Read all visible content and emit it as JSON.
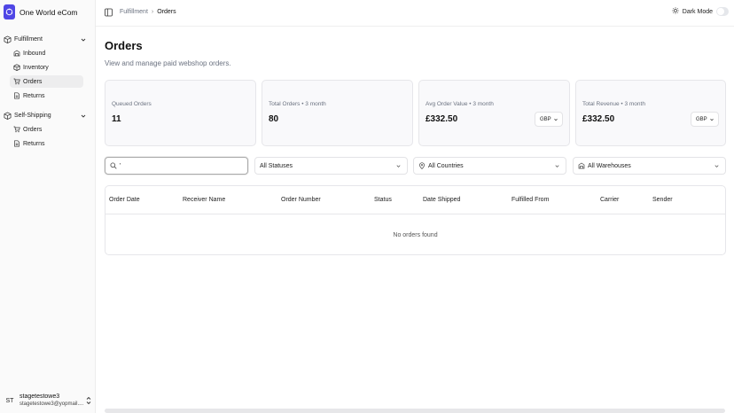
{
  "brand": {
    "name": "One World eCom"
  },
  "sidebar": {
    "groups": [
      {
        "label": "Fulfillment",
        "items": [
          {
            "label": "Inbound"
          },
          {
            "label": "Inventory"
          },
          {
            "label": "Orders"
          },
          {
            "label": "Returns"
          }
        ]
      },
      {
        "label": "Self-Shipping",
        "items": [
          {
            "label": "Orders"
          },
          {
            "label": "Returns"
          }
        ]
      }
    ]
  },
  "user": {
    "initials": "ST",
    "name": "stagetestowe3",
    "email": "stagetestowe3@yopmail...."
  },
  "topbar": {
    "breadcrumb": [
      "Fulfillment",
      "Orders"
    ],
    "dark_mode_label": "Dark Mode"
  },
  "page": {
    "title": "Orders",
    "subtitle": "View and manage paid webshop orders."
  },
  "stats": [
    {
      "label": "Queued Orders",
      "value": "11"
    },
    {
      "label": "Total Orders • 3 month",
      "value": "80"
    },
    {
      "label": "Avg Order Value • 3 month",
      "value": "£332.50",
      "currency": "GBP"
    },
    {
      "label": "Total Revenue • 3 month",
      "value": "£332.50",
      "currency": "GBP"
    }
  ],
  "filters": {
    "search_value": "'",
    "status": "All Statuses",
    "country": "All Countries",
    "warehouse": "All Warehouses"
  },
  "table": {
    "columns": [
      "Order Date",
      "Receiver Name",
      "Order Number",
      "Status",
      "Date Shipped",
      "Fulfilled From",
      "Carrier",
      "Sender"
    ],
    "empty_text": "No orders found"
  },
  "colors": {
    "brand": "#4f46e5",
    "active_nav": "#ededee",
    "card_bg": "#f9f9fb"
  }
}
